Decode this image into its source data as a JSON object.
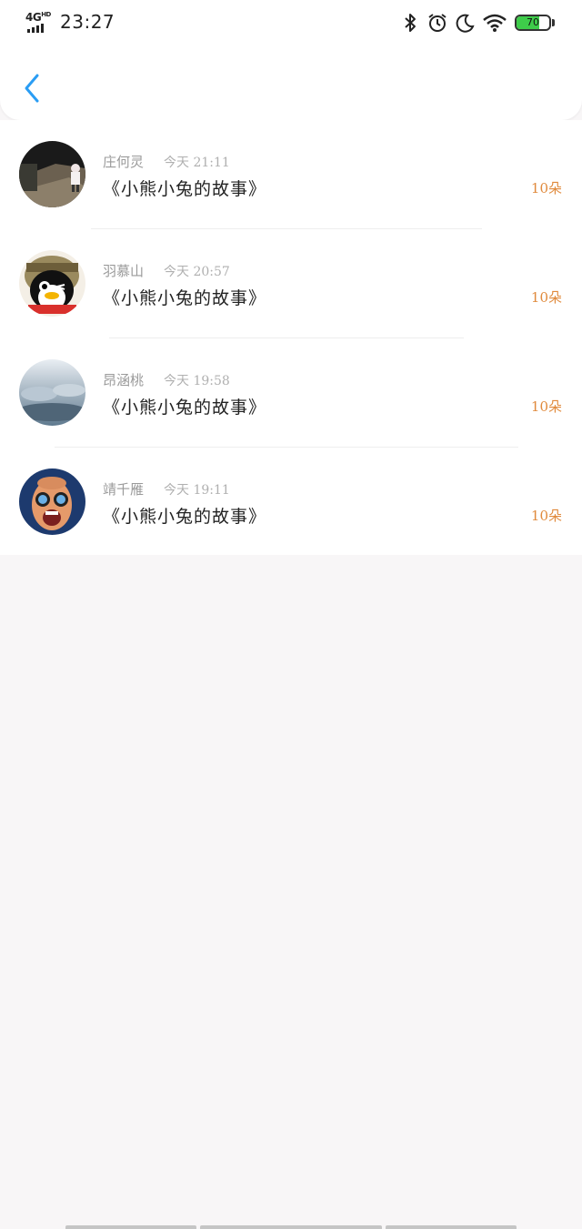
{
  "status_bar": {
    "network": "4G",
    "network_sup": "HD",
    "time": "23:27",
    "battery_percent": 70,
    "battery_label": "70",
    "battery_color": "#3ecc4a",
    "icons": [
      "bluetooth-icon",
      "alarm-icon",
      "moon-icon",
      "wifi-icon",
      "battery-icon"
    ]
  },
  "header": {
    "back_icon": "chevron-left-icon",
    "accent_color": "#2a9df4"
  },
  "records": [
    {
      "name": "庄何灵",
      "time": "今天 21:11",
      "title": "《小熊小兔的故事》",
      "count": "10朵",
      "avatar": "avatar-photo-path"
    },
    {
      "name": "羽慕山",
      "time": "今天 20:57",
      "title": "《小熊小兔的故事》",
      "count": "10朵",
      "avatar": "avatar-penguin-pilot"
    },
    {
      "name": "昂涵桃",
      "time": "今天 19:58",
      "title": "《小熊小兔的故事》",
      "count": "10朵",
      "avatar": "avatar-cloudy-sky"
    },
    {
      "name": "靖千雁",
      "time": "今天 19:11",
      "title": "《小熊小兔的故事》",
      "count": "10朵",
      "avatar": "avatar-cartoon-man"
    }
  ],
  "colors": {
    "count_color": "#e08a3c",
    "background": "#f8f6f7"
  }
}
